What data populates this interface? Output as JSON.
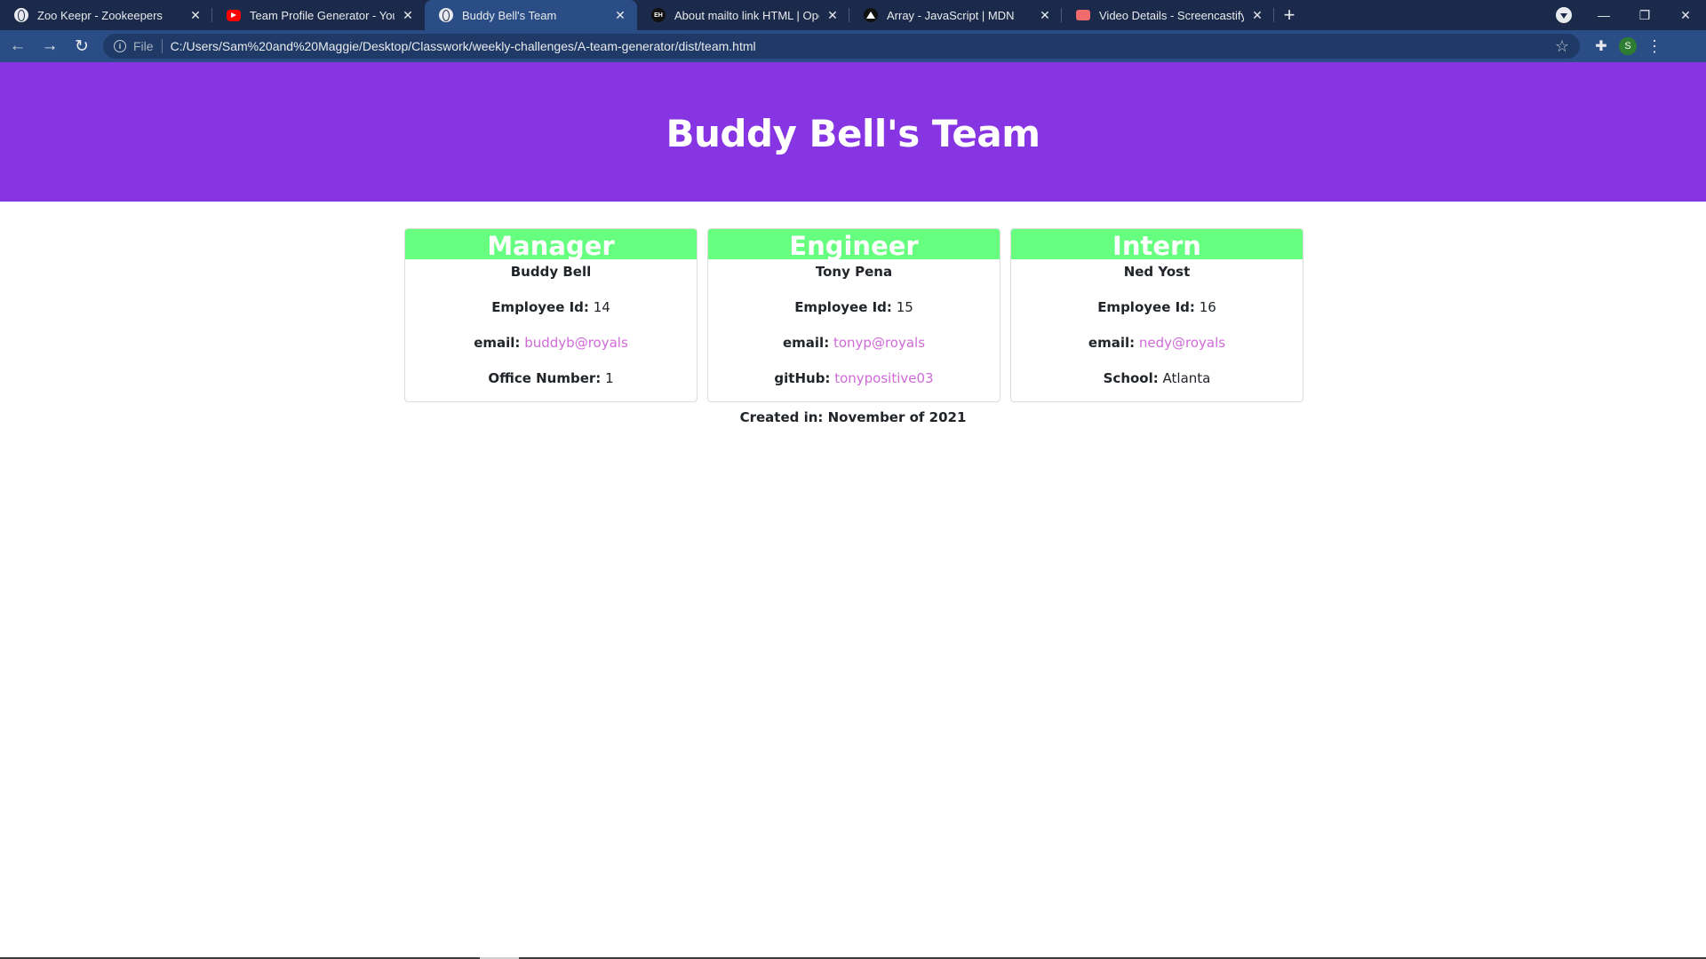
{
  "tabs": [
    {
      "title": "Zoo Keepr - Zookeepers",
      "icon": "globe-icon"
    },
    {
      "title": "Team Profile Generator - YouTube",
      "icon": "youtube-icon"
    },
    {
      "title": "Buddy Bell's Team",
      "icon": "globe-icon",
      "active": true
    },
    {
      "title": "About mailto link HTML | Open d",
      "icon": "eh-icon",
      "icon_text": "EH"
    },
    {
      "title": "Array - JavaScript | MDN",
      "icon": "mdn-icon"
    },
    {
      "title": "Video Details - Screencastify",
      "icon": "screencastify-icon"
    }
  ],
  "toolbar": {
    "scheme": "File",
    "url": "C:/Users/Sam%20and%20Maggie/Desktop/Classwork/weekly-challenges/A-team-generator/dist/team.html",
    "avatar_letter": "S"
  },
  "page": {
    "title": "Buddy Bell's Team",
    "footer": "Created in: November of 2021"
  },
  "cards": [
    {
      "role": "Manager",
      "name": "Buddy Bell",
      "rows": [
        {
          "label": "Employee Id:",
          "value": "14"
        },
        {
          "label": "email:",
          "value": "buddyb@royals"
        },
        {
          "label": "Office Number:",
          "value": "1"
        }
      ]
    },
    {
      "role": "Engineer",
      "name": "Tony Pena",
      "rows": [
        {
          "label": "Employee Id:",
          "value": "15"
        },
        {
          "label": "email:",
          "value": "tonyp@royals"
        },
        {
          "label": "gitHub:",
          "value": "tonypositive03"
        }
      ]
    },
    {
      "role": "Intern",
      "name": "Ned Yost",
      "rows": [
        {
          "label": "Employee Id:",
          "value": "16"
        },
        {
          "label": "email:",
          "value": "nedy@royals"
        },
        {
          "label": "School:",
          "value": "Atlanta"
        }
      ]
    }
  ],
  "colors": {
    "hero": "#8734e3",
    "card_header": "#66ff7f",
    "link": "#d06ad8",
    "tabstrip": "#1b2a4a",
    "toolbar": "#2a4d86"
  }
}
